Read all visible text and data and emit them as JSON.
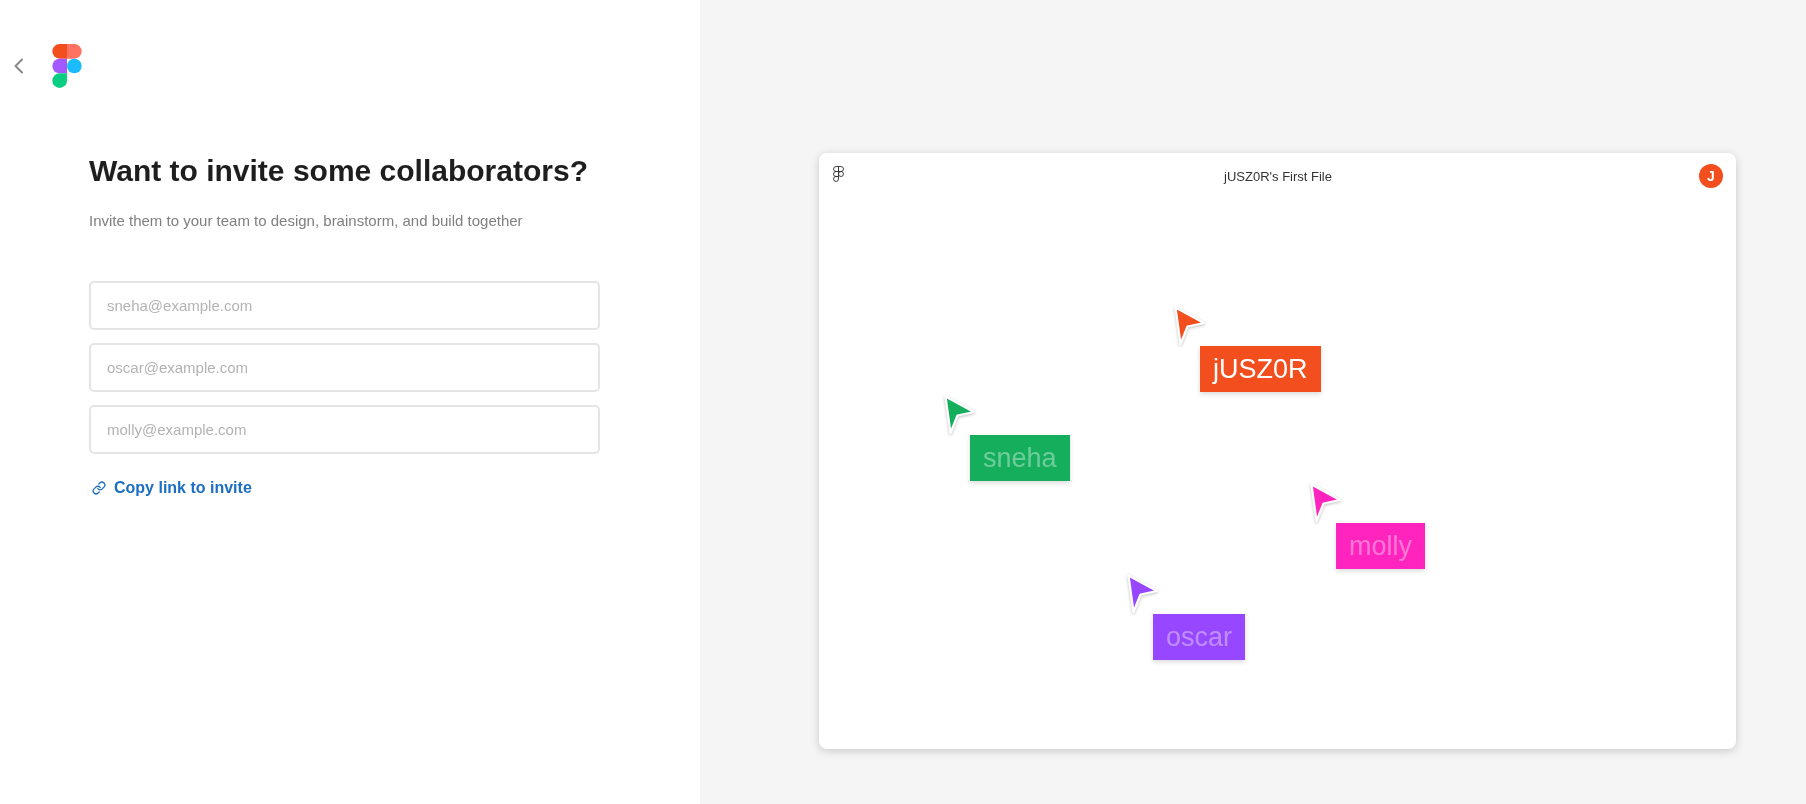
{
  "heading": "Want to invite some collaborators?",
  "subheading": "Invite them to your team to design, brainstorm, and build together",
  "invite_fields": [
    {
      "placeholder": "sneha@example.com"
    },
    {
      "placeholder": "oscar@example.com"
    },
    {
      "placeholder": "molly@example.com"
    }
  ],
  "copy_link": {
    "label": "Copy link to invite"
  },
  "preview": {
    "file_title": "jUSZ0R's First File",
    "avatar_initial": "J",
    "cursors": [
      {
        "name": "jUSZ0R",
        "color": "#f24e1e",
        "active": true
      },
      {
        "name": "sneha",
        "color": "#14ae5c",
        "active": false
      },
      {
        "name": "molly",
        "color": "#ff24bd",
        "active": false
      },
      {
        "name": "oscar",
        "color": "#9747ff",
        "active": false
      }
    ]
  }
}
